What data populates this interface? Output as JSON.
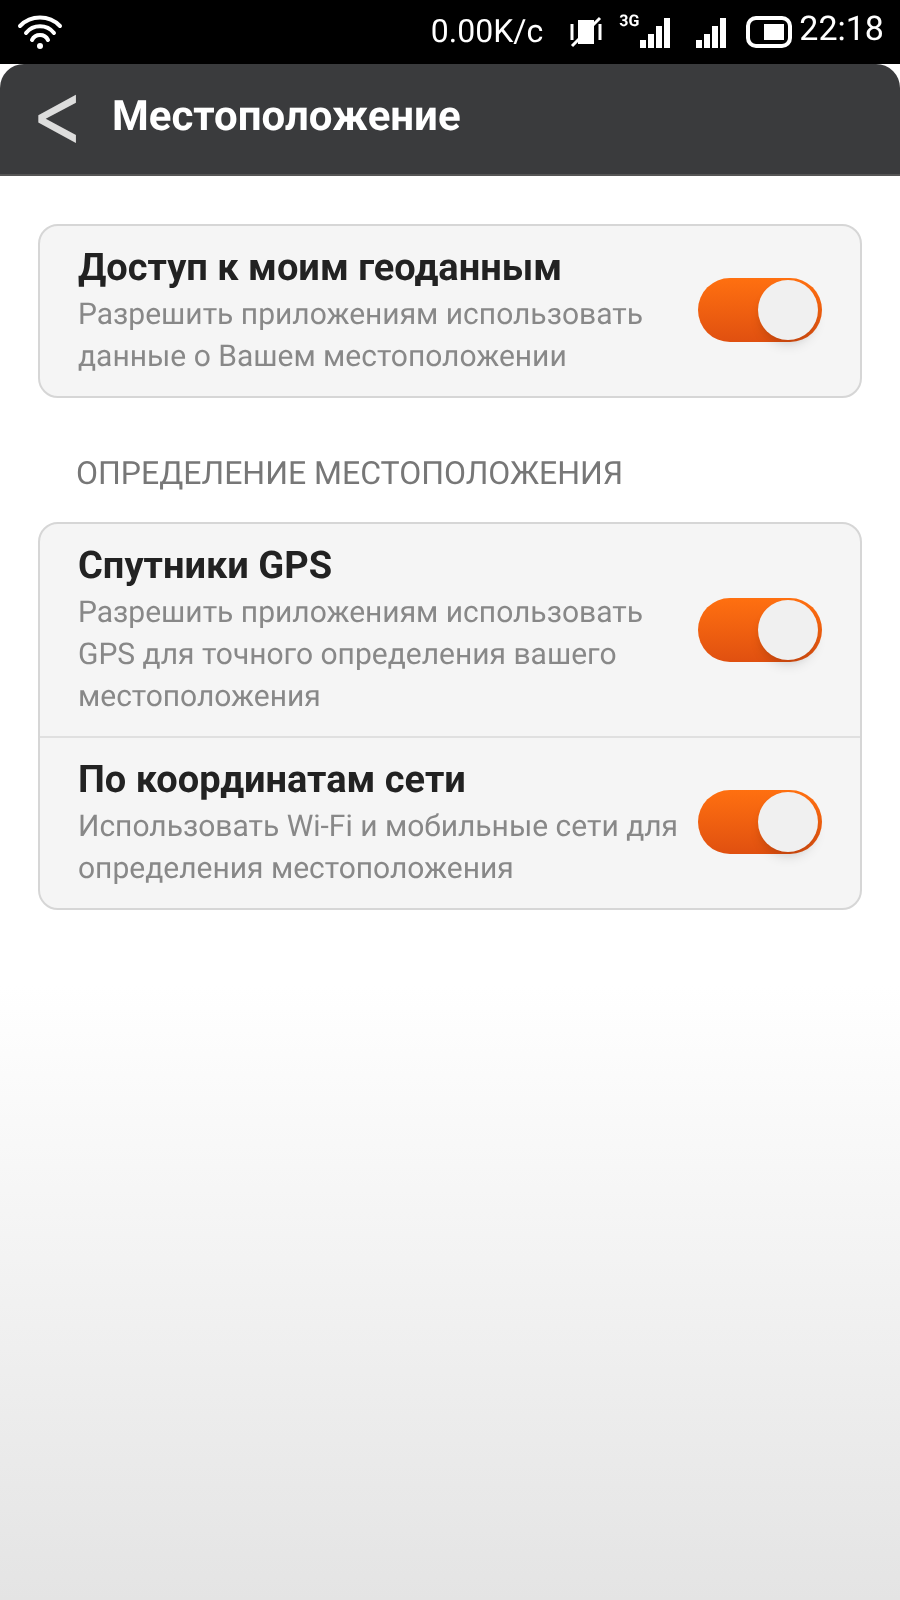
{
  "status_bar": {
    "speed": "0.00K/с",
    "network": "3G",
    "time": "22:18"
  },
  "header": {
    "back": "<",
    "title": "Местоположение"
  },
  "groups": [
    {
      "items": [
        {
          "title": "Доступ к моим геоданным",
          "description": "Разрешить приложениям использовать данные о Вашем местоположении",
          "on": true
        }
      ]
    },
    {
      "heading": "ОПРЕДЕЛЕНИЕ МЕСТОПОЛОЖЕНИЯ",
      "items": [
        {
          "title": "Спутники GPS",
          "description": "Разрешить приложениям использовать GPS для точного определения вашего местоположения",
          "on": true
        },
        {
          "title": "По координатам сети",
          "description": "Использовать Wi-Fi и мобильные сети для определения местоположения",
          "on": true
        }
      ]
    }
  ]
}
